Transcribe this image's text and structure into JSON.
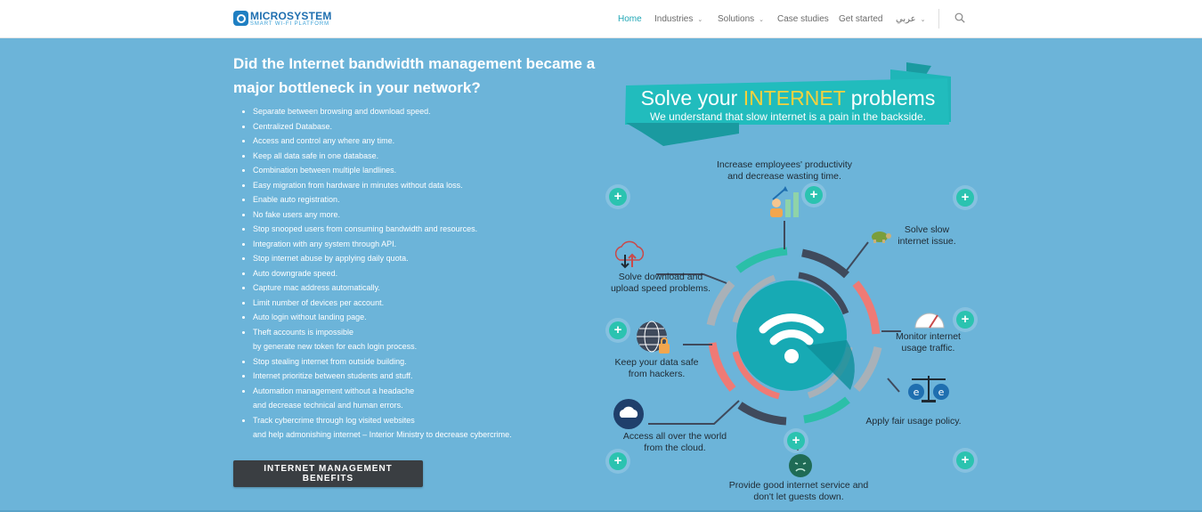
{
  "header": {
    "logo_title": "MICROSYSTEM",
    "logo_subtitle": "SMART WI-FI PLATFORM",
    "nav": [
      {
        "label": "Home",
        "active": true,
        "dropdown": false
      },
      {
        "label": "Industries",
        "active": false,
        "dropdown": true
      },
      {
        "label": "Solutions",
        "active": false,
        "dropdown": true
      },
      {
        "label": "Case studies",
        "active": false,
        "dropdown": false
      },
      {
        "label": "Get started",
        "active": false,
        "dropdown": false
      },
      {
        "label": "عربي",
        "active": false,
        "dropdown": true
      }
    ]
  },
  "main": {
    "headline": "Did the Internet bandwidth management became a major bottleneck in your network?",
    "benefits": [
      [
        "Separate between browsing and download speed."
      ],
      [
        "Centralized Database."
      ],
      [
        "Access and control any where any time."
      ],
      [
        "Keep all data safe in one database."
      ],
      [
        "Combination between multiple landlines."
      ],
      [
        "Easy migration from hardware in minutes without data loss."
      ],
      [
        "Enable auto registration."
      ],
      [
        "No fake users any more."
      ],
      [
        "Stop snooped users from consuming bandwidth and resources."
      ],
      [
        "Integration with any system through API."
      ],
      [
        "Stop internet abuse by applying daily quota."
      ],
      [
        "Auto downgrade speed."
      ],
      [
        "Capture mac address automatically."
      ],
      [
        "Limit number of devices per account."
      ],
      [
        "Auto login without landing page."
      ],
      [
        "Theft accounts is impossible",
        "by generate new token for each login process."
      ],
      [
        "Stop stealing internet from outside building."
      ],
      [
        "Internet prioritize between students and stuff."
      ],
      [
        "Automation management without a headache",
        "and decrease technical and human errors."
      ],
      [
        "Track cybercrime through log visited websites",
        "and help admonishing internet – Interior Ministry to decrease cybercrime."
      ]
    ],
    "cta_label": "INTERNET MANAGEMENT BENEFITS"
  },
  "infographic": {
    "banner_title_pre": "Solve your ",
    "banner_title_highlight": "INTERNET",
    "banner_title_post": " problems",
    "banner_subtitle": "We understand that slow internet is a pain in the backside.",
    "features": {
      "productivity": "Increase employees' productivity\nand decrease wasting time.",
      "slow": "Solve slow\ninternet issue.",
      "speed": "Solve download and\nupload speed problems.",
      "monitor": "Monitor internet\nusage traffic.",
      "hackers": "Keep your data safe\nfrom hackers.",
      "fair": "Apply fair usage policy.",
      "cloud": "Access all over the world\nfrom the cloud.",
      "guests": "Provide good internet service and\ndon't let guests down."
    },
    "plus_symbol": "+",
    "colors": {
      "ring_teal": "#2bbfa8",
      "ring_dark": "#3f4a5c",
      "ring_coral": "#ef7a75",
      "ring_grey": "#a9b1b8",
      "hub_teal": "#17aab4",
      "banner_teal": "#1fb6b8",
      "banner_highlight": "#f4d13d"
    }
  }
}
